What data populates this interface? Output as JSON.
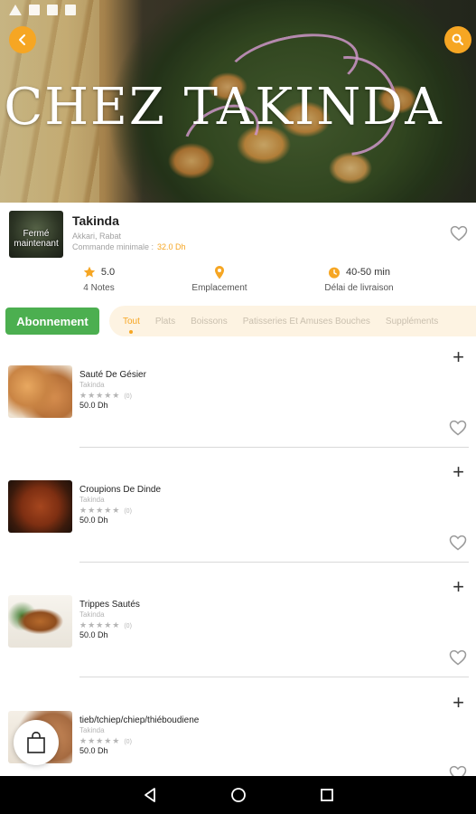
{
  "status_bar": {
    "icons": [
      "warning-icon",
      "image-icon",
      "no-sim-icon",
      "bag-icon"
    ]
  },
  "header": {
    "title": "CHEZ TAKINDA",
    "back_icon": "chevron-left-icon",
    "search_icon": "search-icon"
  },
  "restaurant": {
    "thumbnail_label": "Fermé maintenant",
    "name": "Takinda",
    "address": "Akkari, Rabat",
    "min_order_label": "Commande minimale :",
    "min_order_amount": "32.0 Dh",
    "stats": {
      "rating_value": "5.0",
      "rating_label": "4 Notes",
      "location_label": "Emplacement",
      "delivery_value": "40-50 min",
      "delivery_label": "Délai de livraison"
    }
  },
  "subscribe_label": "Abonnement",
  "tabs": [
    {
      "label": "Tout",
      "active": true
    },
    {
      "label": "Plats",
      "active": false
    },
    {
      "label": "Boissons",
      "active": false
    },
    {
      "label": "Patisseries Et Amuses Bouches",
      "active": false
    },
    {
      "label": "Suppléments",
      "active": false
    }
  ],
  "products": [
    {
      "name": "Sauté De Gésier",
      "restaurant": "Takinda",
      "stars": "★★★★★",
      "reviews": "(0)",
      "price": "50.0 Dh"
    },
    {
      "name": "Croupions De Dinde",
      "restaurant": "Takinda",
      "stars": "★★★★★",
      "reviews": "(0)",
      "price": "50.0 Dh"
    },
    {
      "name": "Trippes Sautés",
      "restaurant": "Takinda",
      "stars": "★★★★★",
      "reviews": "(0)",
      "price": "50.0 Dh"
    },
    {
      "name": "tieb/tchiep/chiep/thiéboudiene",
      "restaurant": "Takinda",
      "stars": "★★★★★",
      "reviews": "(0)",
      "price": "50.0 Dh"
    }
  ],
  "colors": {
    "accent": "#f6a623",
    "subscribe": "#4caf50",
    "tab_bg": "#fdf3e2"
  },
  "nav": {
    "back_icon": "nav-back-icon",
    "home_icon": "nav-home-icon",
    "recents_icon": "nav-recents-icon"
  }
}
